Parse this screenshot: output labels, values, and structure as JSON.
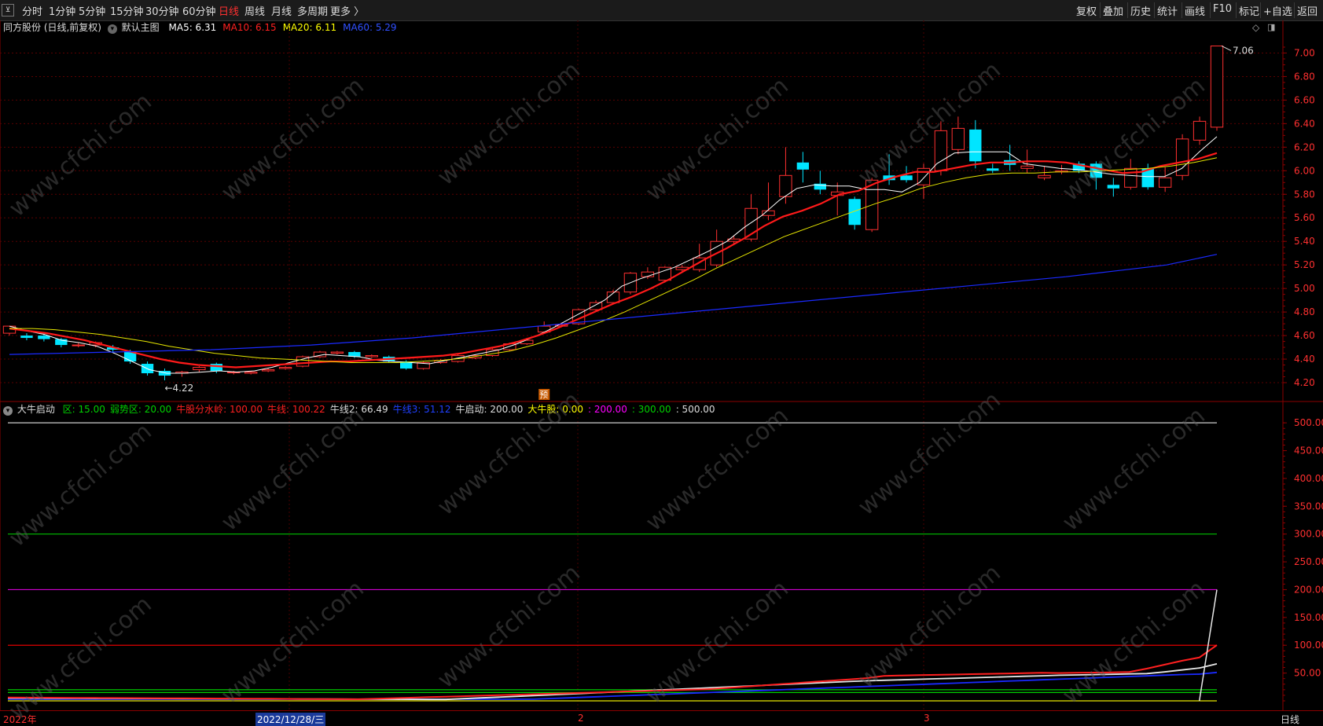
{
  "toolbar": {
    "periods": [
      "分时",
      "1分钟",
      "5分钟",
      "15分钟",
      "30分钟",
      "60分钟",
      "日线",
      "周线",
      "月线",
      "多周期",
      "更多 〉"
    ],
    "active_period": "日线",
    "tools": [
      "复权",
      "叠加",
      "历史",
      "统计",
      "画线",
      "F10",
      "标记",
      "+自选",
      "返回"
    ]
  },
  "main_chart": {
    "title": "同方股份 (日线,前复权)",
    "template": "默认主图",
    "ma": [
      {
        "label": "MA5: 6.31",
        "color": "#ffffff"
      },
      {
        "label": "MA10: 6.15",
        "color": "#ff2020"
      },
      {
        "label": "MA20: 6.11",
        "color": "#ffff00"
      },
      {
        "label": "MA60: 5.29",
        "color": "#2040ff"
      }
    ],
    "high_label": "7.06",
    "low_label": "4.22",
    "marker": "预",
    "y_ticks": [
      "7.00",
      "6.80",
      "6.60",
      "6.40",
      "6.20",
      "6.00",
      "5.80",
      "5.60",
      "5.40",
      "5.20",
      "5.00",
      "4.80",
      "4.60",
      "4.40",
      "4.20"
    ]
  },
  "indicator": {
    "name": "大牛启动",
    "params": [
      {
        "text": "区: 15.00",
        "color": "#00d000"
      },
      {
        "text": "弱势区: 20.00",
        "color": "#00d000"
      },
      {
        "text": "牛股分水岭: 100.00",
        "color": "#ff2020"
      },
      {
        "text": "牛线: 100.22",
        "color": "#ff2020"
      },
      {
        "text": "牛线2: 66.49",
        "color": "#dddddd"
      },
      {
        "text": "牛线3: 51.12",
        "color": "#2040ff"
      },
      {
        "text": "牛启动: 200.00",
        "color": "#dddddd"
      },
      {
        "text": "大牛股: 0.00",
        "color": "#ffff00"
      },
      {
        "text": ": 200.00",
        "color": "#ff00ff"
      },
      {
        "text": ": 300.00",
        "color": "#00d000"
      },
      {
        "text": ": 500.00",
        "color": "#dddddd"
      }
    ],
    "y_ticks": [
      "500.00",
      "450.00",
      "400.00",
      "350.00",
      "300.00",
      "250.00",
      "200.00",
      "150.00",
      "100.00",
      "50.00"
    ]
  },
  "x_axis": {
    "labels": [
      "2022年",
      "2022/12/28/三",
      "2",
      "3"
    ],
    "period_label": "日线"
  },
  "watermark": "www.cfchi.com",
  "chart_data": {
    "type": "candlestick",
    "ylim": [
      4.1,
      7.15
    ],
    "candles": [
      [
        4.62,
        4.68,
        4.68,
        4.6
      ],
      [
        4.6,
        4.58,
        4.62,
        4.56
      ],
      [
        4.6,
        4.57,
        4.62,
        4.55
      ],
      [
        4.57,
        4.52,
        4.58,
        4.5
      ],
      [
        4.52,
        4.52,
        4.54,
        4.5
      ],
      [
        4.52,
        4.54,
        4.55,
        4.5
      ],
      [
        4.5,
        4.48,
        4.52,
        4.46
      ],
      [
        4.46,
        4.38,
        4.48,
        4.36
      ],
      [
        4.36,
        4.28,
        4.38,
        4.26
      ],
      [
        4.3,
        4.26,
        4.32,
        4.22
      ],
      [
        4.28,
        4.29,
        4.3,
        4.25
      ],
      [
        4.31,
        4.33,
        4.34,
        4.29
      ],
      [
        4.36,
        4.3,
        4.37,
        4.28
      ],
      [
        4.29,
        4.29,
        4.3,
        4.27
      ],
      [
        4.28,
        4.29,
        4.3,
        4.27
      ],
      [
        4.3,
        4.31,
        4.32,
        4.29
      ],
      [
        4.32,
        4.33,
        4.34,
        4.31
      ],
      [
        4.34,
        4.42,
        4.43,
        4.33
      ],
      [
        4.42,
        4.46,
        4.47,
        4.41
      ],
      [
        4.45,
        4.46,
        4.47,
        4.44
      ],
      [
        4.46,
        4.42,
        4.47,
        4.41
      ],
      [
        4.42,
        4.43,
        4.44,
        4.41
      ],
      [
        4.42,
        4.38,
        4.43,
        4.37
      ],
      [
        4.38,
        4.32,
        4.39,
        4.31
      ],
      [
        4.32,
        4.37,
        4.38,
        4.31
      ],
      [
        4.37,
        4.39,
        4.4,
        4.36
      ],
      [
        4.38,
        4.43,
        4.44,
        4.37
      ],
      [
        4.41,
        4.43,
        4.44,
        4.4
      ],
      [
        4.43,
        4.48,
        4.49,
        4.42
      ],
      [
        4.48,
        4.53,
        4.54,
        4.47
      ],
      [
        4.53,
        4.56,
        4.58,
        4.52
      ],
      [
        4.63,
        4.68,
        4.72,
        4.62
      ],
      [
        4.68,
        4.69,
        4.71,
        4.67
      ],
      [
        4.7,
        4.82,
        4.83,
        4.69
      ],
      [
        4.82,
        4.88,
        4.9,
        4.8
      ],
      [
        4.88,
        4.97,
        4.99,
        4.87
      ],
      [
        4.97,
        5.13,
        5.14,
        4.95
      ],
      [
        5.1,
        5.14,
        5.18,
        5.08
      ],
      [
        5.07,
        5.18,
        5.19,
        5.05
      ],
      [
        5.16,
        5.18,
        5.2,
        5.14
      ],
      [
        5.16,
        5.26,
        5.38,
        5.14
      ],
      [
        5.2,
        5.4,
        5.5,
        5.18
      ],
      [
        5.4,
        5.42,
        5.45,
        5.38
      ],
      [
        5.42,
        5.68,
        5.8,
        5.4
      ],
      [
        5.62,
        5.66,
        5.9,
        5.58
      ],
      [
        5.78,
        5.96,
        6.2,
        5.72
      ],
      [
        6.07,
        6.01,
        6.16,
        5.9
      ],
      [
        5.89,
        5.84,
        6.0,
        5.8
      ],
      [
        5.79,
        5.82,
        5.9,
        5.62
      ],
      [
        5.76,
        5.54,
        5.78,
        5.5
      ],
      [
        5.5,
        5.92,
        5.94,
        5.48
      ],
      [
        5.96,
        5.92,
        6.14,
        5.88
      ],
      [
        5.96,
        5.92,
        6.04,
        5.9
      ],
      [
        5.88,
        6.02,
        6.06,
        5.76
      ],
      [
        6.0,
        6.34,
        6.42,
        5.96
      ],
      [
        6.18,
        6.36,
        6.46,
        6.14
      ],
      [
        6.35,
        6.08,
        6.43,
        6.02
      ],
      [
        6.02,
        6.0,
        6.06,
        5.98
      ],
      [
        6.09,
        6.05,
        6.22,
        6.0
      ],
      [
        6.02,
        6.04,
        6.18,
        5.98
      ],
      [
        5.94,
        5.96,
        6.04,
        5.92
      ],
      [
        5.99,
        6.0,
        6.05,
        5.97
      ],
      [
        6.06,
        6.0,
        6.08,
        5.98
      ],
      [
        6.06,
        5.94,
        6.08,
        5.84
      ],
      [
        5.88,
        5.85,
        5.94,
        5.78
      ],
      [
        5.86,
        6.02,
        6.1,
        5.84
      ],
      [
        6.02,
        5.86,
        6.06,
        5.84
      ],
      [
        5.86,
        5.94,
        6.03,
        5.82
      ],
      [
        5.96,
        6.27,
        6.31,
        5.92
      ],
      [
        6.26,
        6.42,
        6.46,
        6.22
      ],
      [
        6.37,
        7.06,
        7.06,
        6.34
      ]
    ],
    "series": [
      {
        "name": "MA5",
        "values": [
          4.68,
          4.64,
          4.61,
          4.56,
          4.54,
          4.51,
          4.45,
          4.38,
          4.31,
          4.28,
          4.28,
          4.29,
          4.3,
          4.29,
          4.3,
          4.33,
          4.37,
          4.41,
          4.44,
          4.43,
          4.42,
          4.39,
          4.38,
          4.37,
          4.36,
          4.39,
          4.42,
          4.45,
          4.48,
          4.53,
          4.59,
          4.66,
          4.74,
          4.82,
          4.9,
          5.02,
          5.08,
          5.13,
          5.18,
          5.25,
          5.32,
          5.4,
          5.52,
          5.62,
          5.75,
          5.85,
          5.88,
          5.87,
          5.87,
          5.84,
          5.84,
          5.82,
          5.9,
          6.06,
          6.15,
          6.16,
          6.16,
          6.16,
          6.06,
          6.04,
          6.02,
          6.01,
          5.99,
          5.97,
          5.96,
          5.95,
          5.95,
          6.02,
          6.16,
          6.29
        ]
      },
      {
        "name": "MA10",
        "values": [
          4.66,
          4.64,
          4.62,
          4.59,
          4.56,
          4.52,
          4.48,
          4.44,
          4.4,
          4.37,
          4.35,
          4.34,
          4.33,
          4.34,
          4.35,
          4.36,
          4.37,
          4.38,
          4.38,
          4.39,
          4.4,
          4.41,
          4.42,
          4.43,
          4.45,
          4.48,
          4.51,
          4.55,
          4.6,
          4.66,
          4.73,
          4.8,
          4.87,
          4.93,
          5.0,
          5.08,
          5.17,
          5.26,
          5.34,
          5.43,
          5.53,
          5.61,
          5.66,
          5.72,
          5.8,
          5.83,
          5.9,
          5.95,
          5.99,
          5.99,
          6.02,
          6.05,
          6.07,
          6.07,
          6.08,
          6.08,
          6.07,
          6.04,
          6.01,
          5.98,
          5.99,
          6.04,
          6.07,
          6.1,
          6.15
        ]
      },
      {
        "name": "MA20",
        "values": [
          4.66,
          4.66,
          4.65,
          4.63,
          4.61,
          4.58,
          4.55,
          4.51,
          4.48,
          4.45,
          4.43,
          4.41,
          4.4,
          4.39,
          4.38,
          4.37,
          4.37,
          4.37,
          4.38,
          4.39,
          4.41,
          4.44,
          4.47,
          4.52,
          4.58,
          4.65,
          4.72,
          4.8,
          4.89,
          4.98,
          5.07,
          5.17,
          5.26,
          5.35,
          5.44,
          5.51,
          5.58,
          5.65,
          5.72,
          5.78,
          5.85,
          5.9,
          5.94,
          5.97,
          5.98,
          5.98,
          5.99,
          5.99,
          6.0,
          6.01,
          6.02,
          6.04,
          6.07,
          6.11
        ]
      },
      {
        "name": "MA60",
        "values": [
          4.44,
          4.45,
          4.46,
          4.47,
          4.48,
          4.5,
          4.52,
          4.55,
          4.58,
          4.62,
          4.66,
          4.7,
          4.74,
          4.78,
          4.82,
          4.86,
          4.9,
          4.94,
          4.98,
          5.02,
          5.06,
          5.1,
          5.15,
          5.2,
          5.29
        ]
      }
    ]
  }
}
